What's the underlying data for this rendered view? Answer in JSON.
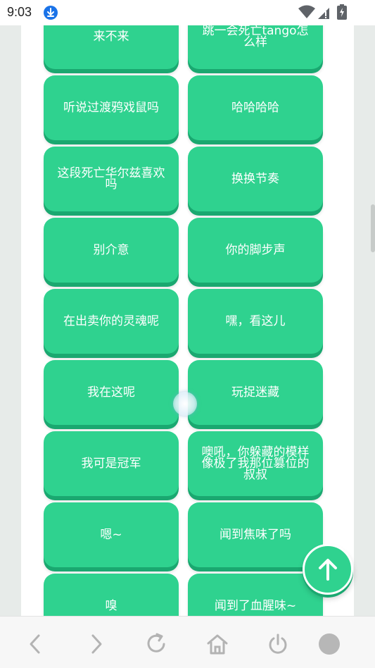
{
  "status_bar": {
    "time": "9:03",
    "icons": [
      "download-icon",
      "wifi-icon",
      "signal-icon",
      "battery-icon"
    ]
  },
  "colors": {
    "card": "#2fd28f",
    "card_shadow": "#1aa870",
    "page_background": "#e7ebe9"
  },
  "phrases": [
    "来不来",
    "跳一会死亡tango怎么样",
    "听说过渡鸦戏鼠吗",
    "哈哈哈哈",
    "这段死亡华尔兹喜欢吗",
    "换换节奏",
    "别介意",
    "你的脚步声",
    "在出卖你的灵魂呢",
    "嘿，看这儿",
    "我在这呢",
    "玩捉迷藏",
    "我可是冠军",
    "噢吼，你躲藏的模样像极了我那位篡位的叔叔",
    "嗯~",
    "闻到焦味了吗",
    "嗅",
    "闻到了血腥味~"
  ],
  "fab": {
    "icon": "arrow-up-icon"
  },
  "bottom_nav": {
    "items": [
      "back-icon",
      "forward-icon",
      "refresh-icon",
      "home-icon",
      "power-icon",
      "tabs-circle-icon"
    ]
  }
}
